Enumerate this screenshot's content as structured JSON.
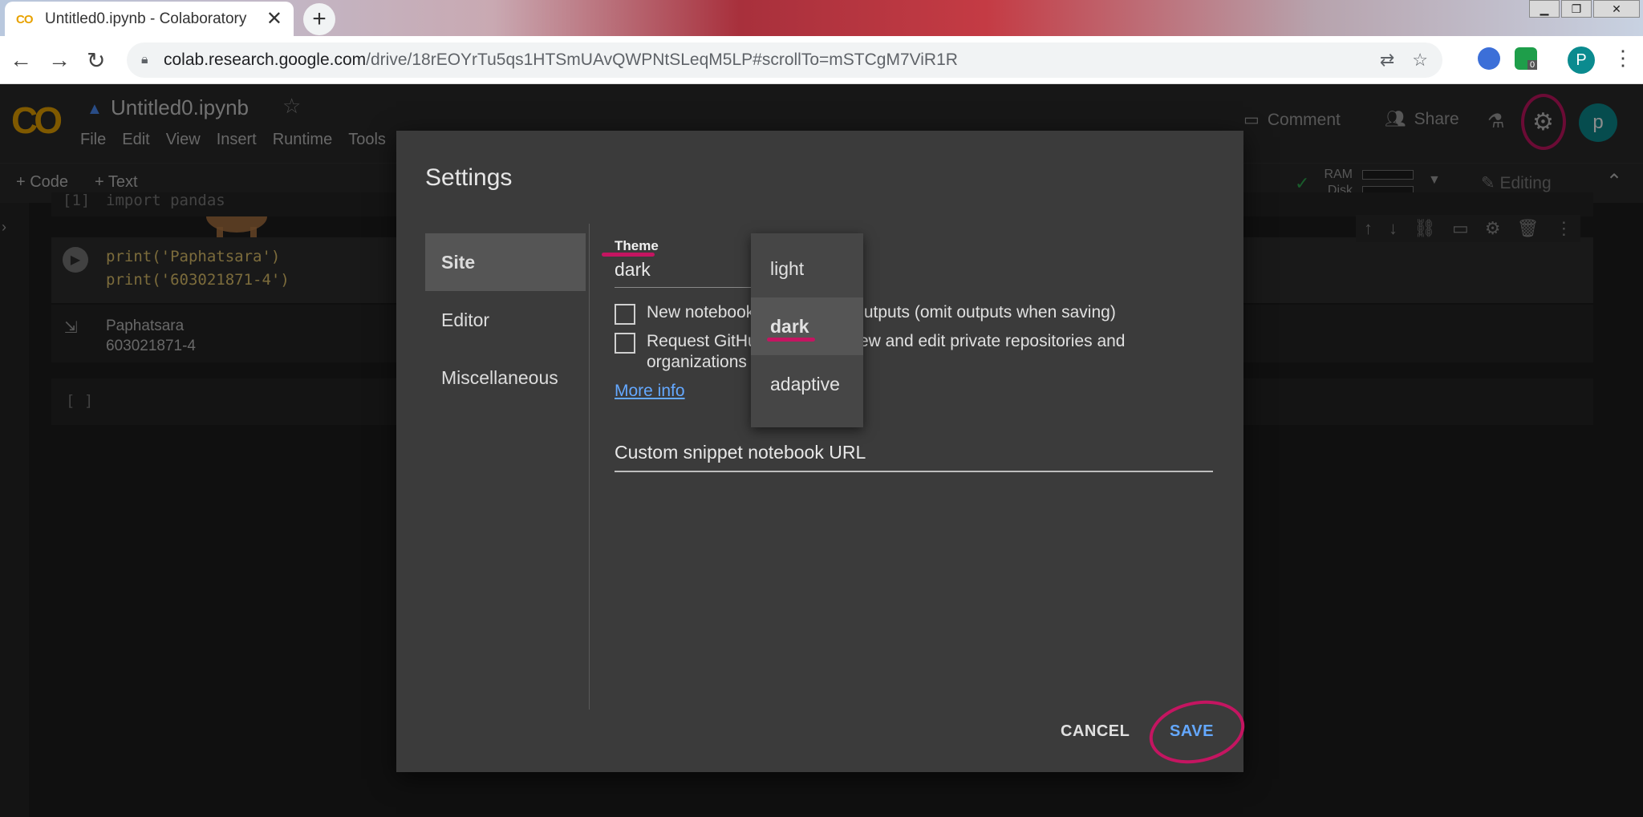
{
  "browser": {
    "tab_title": "Untitled0.ipynb - Colaboratory",
    "tab_favicon": "CO",
    "url_host": "colab.research.google.com",
    "url_path": "/drive/18rEOYrTu5qs1HTSmUAvQWPNtSLeqM5LP#scrollTo=mSTCgM7ViR1R",
    "profile_initial": "P",
    "extension_badge": "0"
  },
  "colab": {
    "logo": "CO",
    "notebook_title": "Untitled0.ipynb",
    "menu": [
      "File",
      "Edit",
      "View",
      "Insert",
      "Runtime",
      "Tools"
    ],
    "comment_label": "Comment",
    "share_label": "Share",
    "avatar_initial": "p",
    "add_code_label": "+ Code",
    "add_text_label": "+ Text",
    "ram_label": "RAM",
    "disk_label": "Disk",
    "editing_label": "Editing"
  },
  "cells": {
    "hidden_prompt": "[1]",
    "hidden_code": "import pandas",
    "code_line1": "print('Paphatsara')",
    "code_line2": "print('603021871-4')",
    "output_line1": "Paphatsara",
    "output_line2": "603021871-4",
    "empty_prompt": "[ ]"
  },
  "settings": {
    "title": "Settings",
    "nav": [
      "Site",
      "Editor",
      "Miscellaneous"
    ],
    "theme_label": "Theme",
    "theme_value": "dark",
    "theme_options": [
      "light",
      "dark",
      "adaptive"
    ],
    "checkbox1_text": "New notebooks use private outputs (omit outputs when saving)",
    "checkbox2_text": "Request GitHub access to view and edit private repositories and organizations",
    "more_info": "More info",
    "snippet_label": "Custom snippet notebook URL",
    "cancel_label": "CANCEL",
    "save_label": "SAVE"
  },
  "colors": {
    "annotation": "#c41561",
    "link": "#64a8ff",
    "brand": "#e8a200"
  }
}
